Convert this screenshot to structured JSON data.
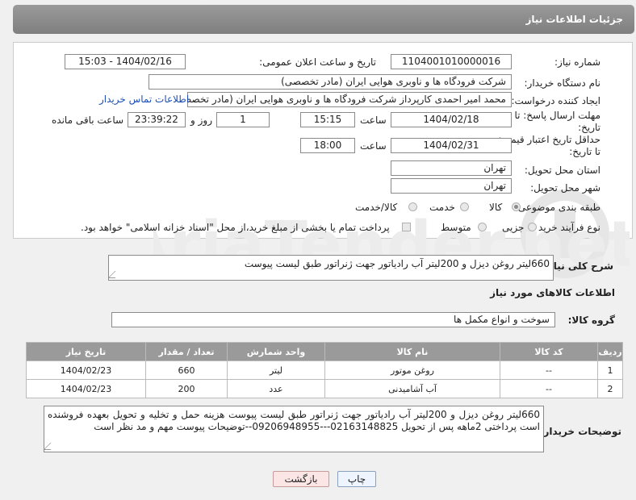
{
  "header": {
    "title": "جزئیات اطلاعات نیاز"
  },
  "form": {
    "need_number": {
      "label": "شماره نیاز:",
      "value": "1104001010000016"
    },
    "announce": {
      "label": "تاریخ و ساعت اعلان عمومی:",
      "value": "1404/02/16 - 15:03"
    },
    "buyer_org": {
      "label": "نام دستگاه خریدار:",
      "value": "شرکت فرودگاه ها و ناوبری هوایی ایران (مادر تخصصی)"
    },
    "creator": {
      "label": "ایجاد کننده درخواست:",
      "value": "محمد امیر احمدی کارپرداز شرکت فرودگاه ها و ناوبری هوایی ایران (مادر تخصصی",
      "contact_link": "اطلاعات تماس خریدار"
    },
    "deadline": {
      "label": "مهلت ارسال پاسخ: تا تاریخ:",
      "date": "1404/02/18",
      "time_label": "ساعت",
      "time": "15:15",
      "days": "1",
      "days_label": "روز و",
      "remaining": "23:39:22",
      "remaining_label": "ساعت باقی مانده"
    },
    "validity": {
      "label": "حداقل تاریخ اعتبار قیمت: تا تاریخ:",
      "date": "1404/02/31",
      "time_label": "ساعت",
      "time": "18:00"
    },
    "province": {
      "label": "استان محل تحویل:",
      "value": "تهران"
    },
    "city": {
      "label": "شهر محل تحویل:",
      "value": "تهران"
    },
    "category": {
      "label": "طبقه بندی موضوعی:",
      "options": [
        "کالا",
        "خدمت",
        "کالا/خدمت"
      ],
      "selected": "کالا"
    },
    "process": {
      "label": "نوع فرآیند خرید :",
      "options": [
        "جزیی",
        "متوسط"
      ],
      "note": "پرداخت تمام یا بخشی از مبلغ خرید،از محل \"اسناد خزانه اسلامی\" خواهد بود."
    }
  },
  "description": {
    "label": "شرح کلی نیاز:",
    "value": "660لیتر روغن دیزل  و 200لیتر آب رادیاتور جهت ژنراتور طبق لیست پیوست"
  },
  "goods": {
    "section_title": "اطلاعات کالاهای مورد نیاز",
    "group_label": "گروه کالا:",
    "group_value": "سوخت و انواع مکمل ها",
    "columns": [
      "ردیف",
      "کد کالا",
      "نام کالا",
      "واحد شمارش",
      "تعداد / مقدار",
      "تاریخ نیاز"
    ],
    "rows": [
      [
        "1",
        "--",
        "روغن موتور",
        "لیتر",
        "660",
        "1404/02/23"
      ],
      [
        "2",
        "--",
        "آب آشامیدنی",
        "عدد",
        "200",
        "1404/02/23"
      ]
    ]
  },
  "buyer_notes": {
    "label": "توضیحات خریدار:",
    "value": "660لیتر روغن دیزل  و 200لیتر آب رادیاتور جهت ژنراتور طبق لیست پیوست هزینه حمل و تخلیه و تحویل بعهده فروشنده است پرداختی 2ماهه پس از تحویل 02163148825---09206948955--توضیحات پیوست مهم و مد نظر است"
  },
  "buttons": {
    "print": "چاپ",
    "back": "بازگشت"
  }
}
